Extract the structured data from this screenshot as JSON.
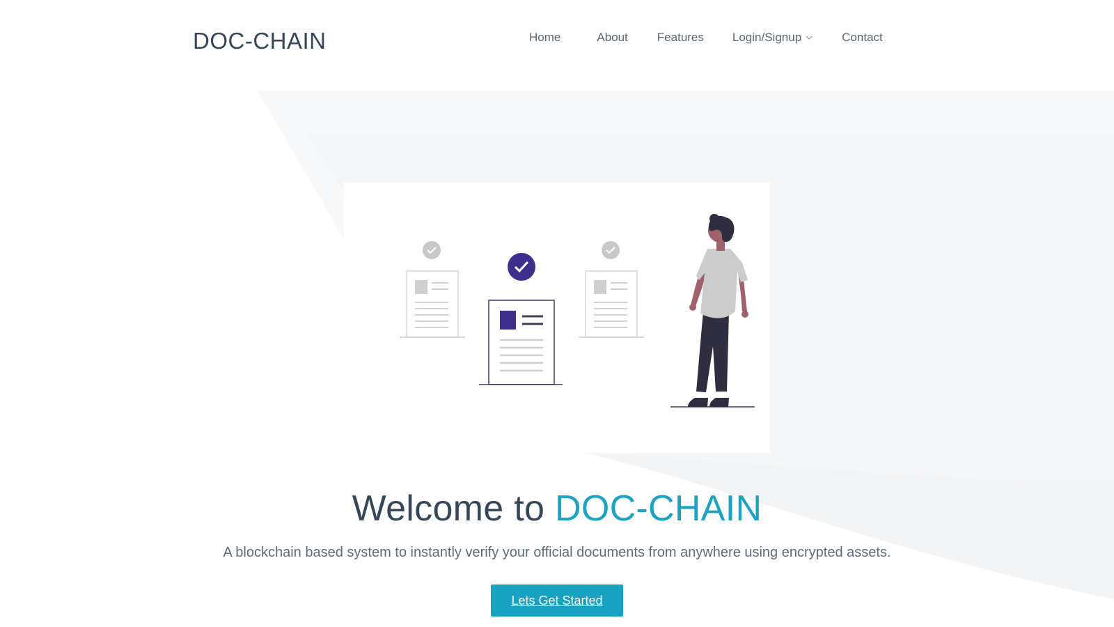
{
  "header": {
    "logo": "DOC-CHAIN",
    "nav": {
      "home": "Home",
      "about": "About",
      "features": "Features",
      "login": "Login/Signup",
      "contact": "Contact"
    }
  },
  "hero": {
    "welcome_prefix": "Welcome to ",
    "welcome_brand": "DOC-CHAIN",
    "tagline": "A blockchain based system to instantly verify your official documents from anywhere using encrypted assets.",
    "cta_label": "Lets Get Started"
  },
  "colors": {
    "accent": "#16a2c0",
    "heading": "#37475a",
    "illustration_primary": "#3f2f8c",
    "person_shirt": "#cccccc",
    "person_pants": "#2f2e41",
    "skin": "#a0616a"
  },
  "icons": {
    "chevron": "chevron-down-icon",
    "check": "check-circle-icon"
  }
}
